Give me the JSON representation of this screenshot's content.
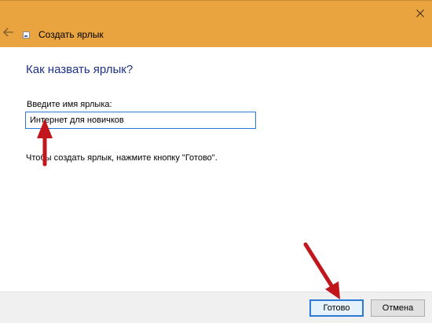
{
  "window": {
    "title": "Создать ярлык",
    "titlebar_color": "#e9a43f",
    "icons": [
      "back-arrow-icon",
      "shortcut-wizard-icon",
      "close-icon"
    ]
  },
  "main": {
    "heading": "Как назвать ярлык?",
    "field_label": "Введите имя ярлыка:",
    "name_value": "Интернет для новичков",
    "hint": "Чтобы создать ярлык, нажмите кнопку \"Готово\"."
  },
  "footer": {
    "done_label": "Готово",
    "cancel_label": "Отмена"
  },
  "annotations": {
    "arrow_color": "#c0161c",
    "arrows": [
      "to-name-field",
      "to-done-button"
    ]
  }
}
